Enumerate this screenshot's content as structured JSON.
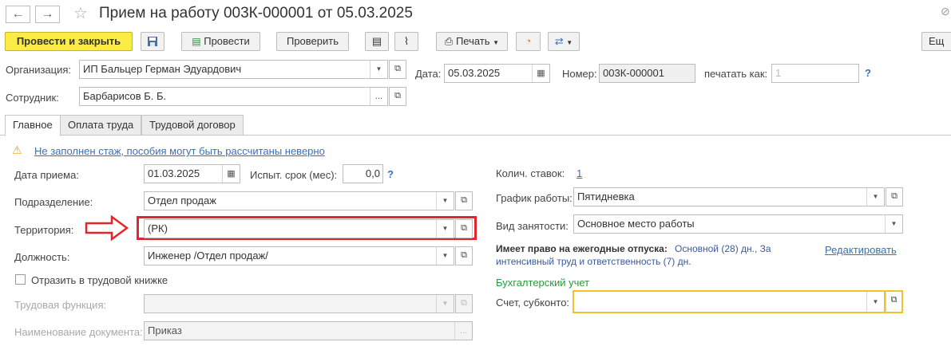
{
  "window": {
    "title": "Прием на работу 003К-000001 от 05.03.2025"
  },
  "toolbar": {
    "post_close": "Провести и закрыть",
    "post": "Провести",
    "check": "Проверить",
    "print": "Печать",
    "more": "Ещ"
  },
  "header": {
    "org_label": "Организация:",
    "org_value": "ИП Бальцер Герман Эдуардович",
    "date_label": "Дата:",
    "date_value": "05.03.2025",
    "number_label": "Номер:",
    "number_value": "003К-000001",
    "print_as_label": "печатать как:",
    "print_as_value": "1",
    "help": "?",
    "employee_label": "Сотрудник:",
    "employee_value": "Барбарисов Б. Б."
  },
  "tabs": [
    "Главное",
    "Оплата труда",
    "Трудовой договор"
  ],
  "main": {
    "warning": "Не заполнен стаж, пособия могут быть рассчитаны неверно",
    "hire_date_label": "Дата приема:",
    "hire_date_value": "01.03.2025",
    "trial_label": "Испыт. срок (мес):",
    "trial_value": "0,0",
    "help": "?",
    "dept_label": "Подразделение:",
    "dept_value": "Отдел продаж",
    "territory_label": "Территория:",
    "territory_value": "(РК)",
    "position_label": "Должность:",
    "position_value": "Инженер /Отдел продаж/",
    "workbook_label": "Отразить в трудовой книжке",
    "labor_func_label": "Трудовая функция:",
    "doc_name_label": "Наименование документа:",
    "doc_name_value": "Приказ"
  },
  "right": {
    "rates_label": "Колич. ставок:",
    "rates_value": "1",
    "schedule_label": "График работы:",
    "schedule_value": "Пятидневка",
    "employment_label": "Вид занятости:",
    "employment_value": "Основное место работы",
    "vacation_label": "Имеет право на ежегодные отпуска:",
    "vacation_line1": "Основной (28) дн., За",
    "vacation_line2": "интенсивный труд и ответственность (7) дн.",
    "edit_link": "Редактировать",
    "accounting_title": "Бухгалтерский учет",
    "account_label": "Счет, субконто:"
  },
  "colors": {
    "primary": "#fbed45",
    "link": "#3a6fba",
    "highlight": "#e3262b",
    "accent_green": "#2a9a3a",
    "active_field": "#f0c230"
  }
}
